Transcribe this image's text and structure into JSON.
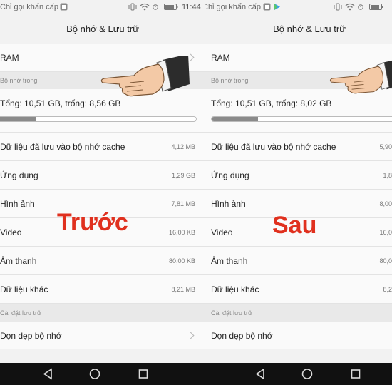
{
  "left": {
    "status": {
      "carrier": "Chỉ gọi khẩn cấp",
      "time": "11:44"
    },
    "title": "Bộ nhớ & Lưu trữ",
    "ram_label": "RAM",
    "section_internal": "Bộ nhớ trong",
    "storage_summary": "Tổng: 10,51 GB, trống: 8,56 GB",
    "storage_used_fraction": 0.19,
    "items": [
      {
        "label": "Dữ liệu đã lưu vào bộ nhớ cache",
        "value": "4,12 MB"
      },
      {
        "label": "Ứng dụng",
        "value": "1,29 GB"
      },
      {
        "label": "Hình ảnh",
        "value": "7,81 MB"
      },
      {
        "label": "Video",
        "value": "16,00 KB"
      },
      {
        "label": "Âm thanh",
        "value": "80,00 KB"
      },
      {
        "label": "Dữ liệu khác",
        "value": "8,21 MB"
      }
    ],
    "section_settings": "Cài đặt lưu trữ",
    "cleanup_label": "Dọn dẹp bộ nhớ",
    "overlay": "Trước"
  },
  "right": {
    "status": {
      "carrier": "Chỉ gọi khẩn cấp"
    },
    "title": "Bộ nhớ & Lưu trữ",
    "ram_label": "RAM",
    "section_internal": "Bộ nhớ trong",
    "storage_summary": "Tổng: 10,51 GB, trống: 8,02 GB",
    "storage_used_fraction": 0.24,
    "items": [
      {
        "label": "Dữ liệu đã lưu vào bộ nhớ cache",
        "value": "5,90"
      },
      {
        "label": "Ứng dụng",
        "value": "1,8"
      },
      {
        "label": "Hình ảnh",
        "value": "8,00"
      },
      {
        "label": "Video",
        "value": "16,0"
      },
      {
        "label": "Âm thanh",
        "value": "80,0"
      },
      {
        "label": "Dữ liệu khác",
        "value": "8,2"
      }
    ],
    "section_settings": "Cài đặt lưu trữ",
    "cleanup_label": "Dọn dẹp bộ nhớ",
    "overlay": "Sau"
  },
  "icons": {
    "ram_chevron": "chevron-right-icon",
    "cleanup_chevron": "chevron-right-icon",
    "pointer": "pointing-hand-icon",
    "nav_back": "back-triangle-icon",
    "nav_home": "home-circle-icon",
    "nav_recent": "recent-square-icon"
  },
  "colors": {
    "overlay": "#e0301e",
    "navbar": "#111111",
    "bar_fill": "#8a8a8a"
  }
}
